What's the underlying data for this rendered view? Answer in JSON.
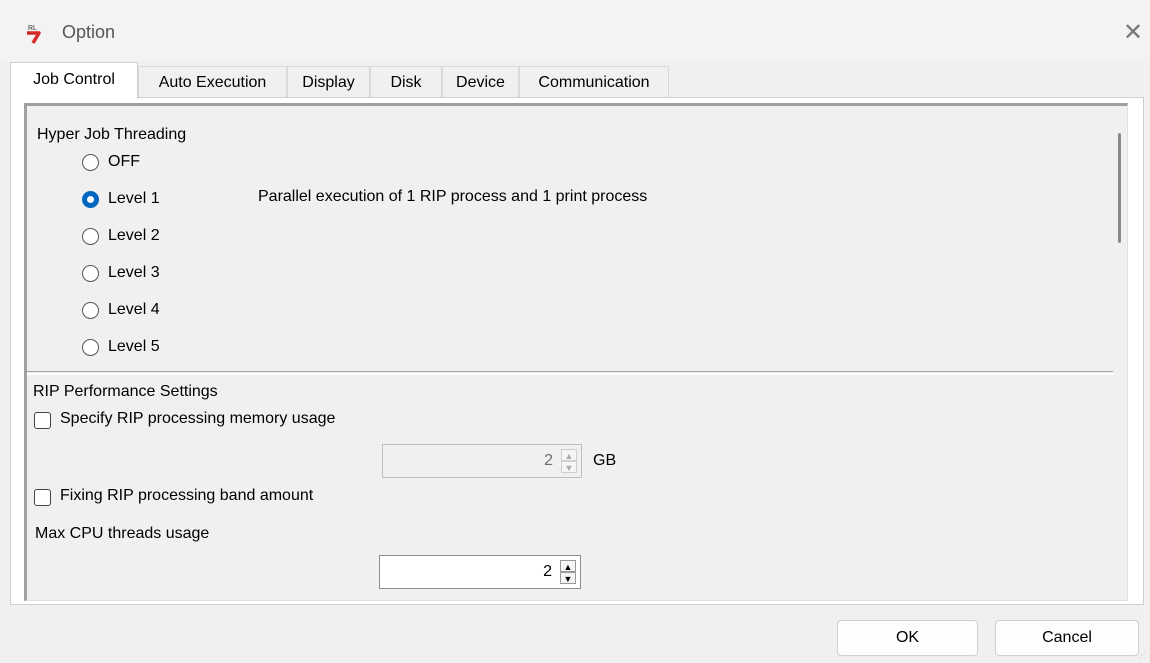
{
  "window": {
    "title": "Option",
    "close_symbol": "✕"
  },
  "tabs": [
    {
      "label": "Job Control",
      "active": true
    },
    {
      "label": "Auto Execution",
      "active": false
    },
    {
      "label": "Display",
      "active": false
    },
    {
      "label": "Disk",
      "active": false
    },
    {
      "label": "Device",
      "active": false
    },
    {
      "label": "Communication",
      "active": false
    }
  ],
  "hyper_job": {
    "heading": "Hyper Job Threading",
    "options": [
      "OFF",
      "Level 1",
      "Level 2",
      "Level 3",
      "Level 4",
      "Level 5"
    ],
    "selected": "Level 1",
    "description": "Parallel execution of 1 RIP process and 1 print process"
  },
  "rip_performance": {
    "heading": "RIP Performance Settings",
    "memory_checkbox_label": "Specify RIP processing memory usage",
    "memory_checked": false,
    "memory_value": "2",
    "memory_unit": "GB",
    "band_checkbox_label": "Fixing RIP processing band amount",
    "band_checked": false,
    "cpu_label": "Max CPU threads usage",
    "cpu_value": "2"
  },
  "footer": {
    "ok_label": "OK",
    "cancel_label": "Cancel"
  },
  "colors": {
    "accent": "#0067c0",
    "dialog_bg": "#f0f0f0"
  },
  "icons": {
    "app": "app-logo-icon",
    "close": "close-icon"
  }
}
